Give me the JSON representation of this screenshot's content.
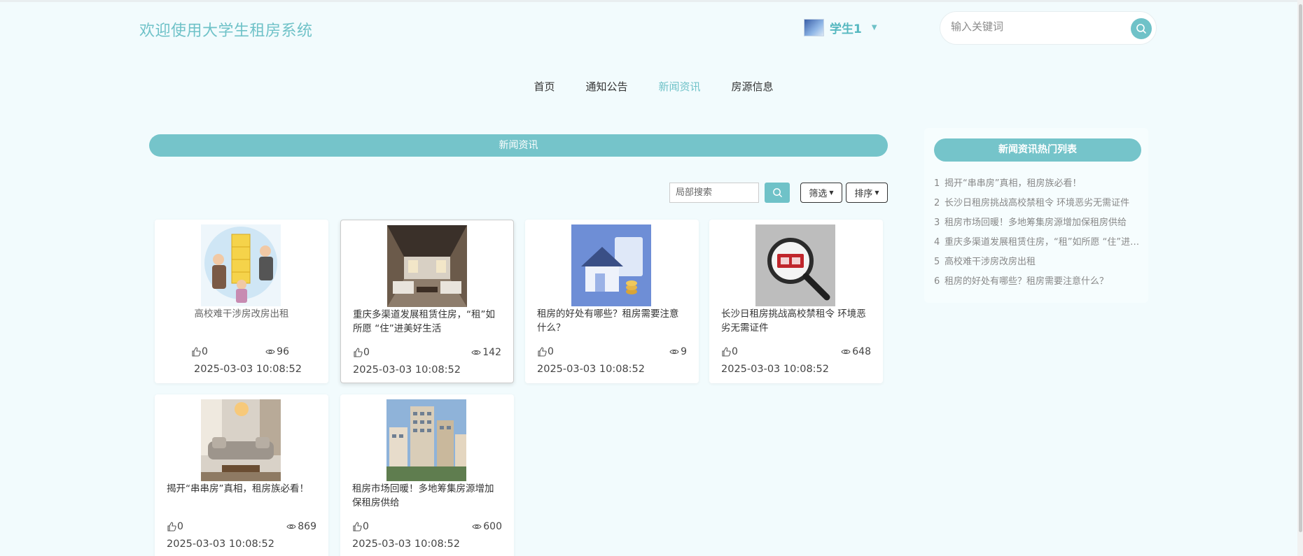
{
  "header": {
    "site_title": "欢迎使用大学生租房系统",
    "user_name": "学生1",
    "search_placeholder": "输入关键词"
  },
  "nav": [
    {
      "label": "首页",
      "active": false
    },
    {
      "label": "通知公告",
      "active": false
    },
    {
      "label": "新闻资讯",
      "active": true
    },
    {
      "label": "房源信息",
      "active": false
    }
  ],
  "main": {
    "section_title": "新闻资讯",
    "local_search_placeholder": "局部搜索",
    "filter_label": "筛选",
    "sort_label": "排序"
  },
  "cards": [
    {
      "title": "高校难干涉房改房出租",
      "likes": "0",
      "views": "96",
      "date": "2025-03-03 10:08:52",
      "image": "cartoon-people-carrying-box"
    },
    {
      "title": "重庆多渠道发展租赁住房，“租”如所愿 “住”进美好生活",
      "likes": "0",
      "views": "142",
      "date": "2025-03-03 10:08:52",
      "image": "modern-living-room"
    },
    {
      "title": "租房的好处有哪些？租房需要注意什么？",
      "likes": "0",
      "views": "9",
      "date": "2025-03-03 10:08:52",
      "image": "house-model-with-coins"
    },
    {
      "title": "长沙日租房挑战高校禁租令 环境恶劣无需证件",
      "likes": "0",
      "views": "648",
      "date": "2025-03-03 10:08:52",
      "image": "magnifier-rent-sign"
    },
    {
      "title": "揭开“串串房”真相，租房族必看！",
      "likes": "0",
      "views": "869",
      "date": "2025-03-03 10:08:52",
      "image": "cozy-living-room-sofa"
    },
    {
      "title": "租房市场回暖！多地筹集房源增加保租房供给",
      "likes": "0",
      "views": "600",
      "date": "2025-03-03 10:08:52",
      "image": "city-apartment-buildings"
    }
  ],
  "sidebar": {
    "title": "新闻资讯热门列表",
    "items": [
      {
        "num": "1",
        "label": "揭开“串串房”真相，租房族必看！"
      },
      {
        "num": "2",
        "label": "长沙日租房挑战高校禁租令 环境恶劣无需证件"
      },
      {
        "num": "3",
        "label": "租房市场回暖！多地筹集房源增加保租房供给"
      },
      {
        "num": "4",
        "label": "重庆多渠道发展租赁住房，“租”如所愿 “住”进美好生活"
      },
      {
        "num": "5",
        "label": "高校难干涉房改房出租"
      },
      {
        "num": "6",
        "label": "租房的好处有哪些？租房需要注意什么？"
      }
    ]
  },
  "colors": {
    "accent": "#6fc2c8",
    "page_bg": "#f2fbfd"
  },
  "icons": {
    "search": "search-icon",
    "like": "thumb-up-icon",
    "view": "eye-icon",
    "caret": "caret-down-icon"
  }
}
